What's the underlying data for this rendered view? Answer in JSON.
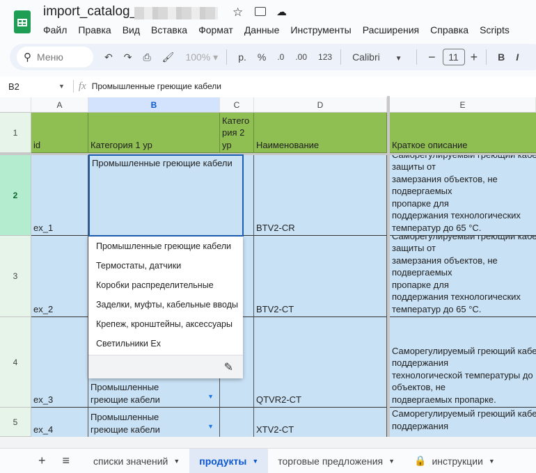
{
  "app": {
    "title": "import_catalog_",
    "accent": "#0b57d0"
  },
  "menu": [
    "Файл",
    "Правка",
    "Вид",
    "Вставка",
    "Формат",
    "Данные",
    "Инструменты",
    "Расширения",
    "Справка",
    "Scripts"
  ],
  "toolbar": {
    "search_placeholder": "Меню",
    "zoom": "100%",
    "currency": "р.",
    "percent": "%",
    "dec_less": ".0",
    "dec_more": ".00",
    "number_format": "123",
    "font": "Calibri",
    "font_size": "11",
    "bold": "B",
    "italic": "I"
  },
  "formula_bar": {
    "cell_ref": "B2",
    "fx": "fx",
    "value": "Промышленные греющие кабели"
  },
  "columns": [
    "A",
    "B",
    "C",
    "D",
    "E"
  ],
  "rows": [
    "1",
    "2",
    "3",
    "4",
    "5"
  ],
  "header": {
    "a": "id",
    "b": "Категория 1 ур",
    "c": "Катего\nрия 2\nур",
    "d": "Наименование",
    "e": "Краткое описание"
  },
  "data": [
    {
      "a": "ex_1",
      "b": "Промышленные греющие кабели",
      "d": "BTV2-CR",
      "e": "Саморегулируемый греющий кабель\nзащиты от\nзамерзания объектов, не подвергаемых\nпропарке для\nподдержания технологических\nтемператур до 65 °С."
    },
    {
      "a": "ex_2",
      "b": "",
      "d": "BTV2-CT",
      "e": "Саморегулируемый греющий кабель\nзащиты от\nзамерзания объектов, не подвергаемых\nпропарке для\nподдержания технологических\nтемператур до 65 °С."
    },
    {
      "a": "ex_3",
      "b": "Промышленные\nгреющие кабели",
      "d": "QTVR2-CT",
      "e": "Саморегулируемый греющий кабель\nподдержания\nтехнологической температуры до\nобъектов, не\nподвергаемых пропарке."
    },
    {
      "a": "ex_4",
      "b": "Промышленные\nгреющие кабели",
      "d": "XTV2-CT",
      "e": "Саморегулируемый греющий кабель\nподдержания\n"
    }
  ],
  "dropdown": {
    "options": [
      "Промышленные греющие кабели",
      "Термостаты, датчики",
      "Коробки распределительные",
      "Заделки, муфты, кабельные вводы",
      "Крепеж, кронштейны, аксессуары",
      "Светильники Ex"
    ]
  },
  "sheets": [
    {
      "label": "списки значений",
      "active": false
    },
    {
      "label": "продукты",
      "active": true
    },
    {
      "label": "торговые предложения",
      "active": false
    },
    {
      "label": "инструкции",
      "active": false,
      "locked": true
    }
  ]
}
